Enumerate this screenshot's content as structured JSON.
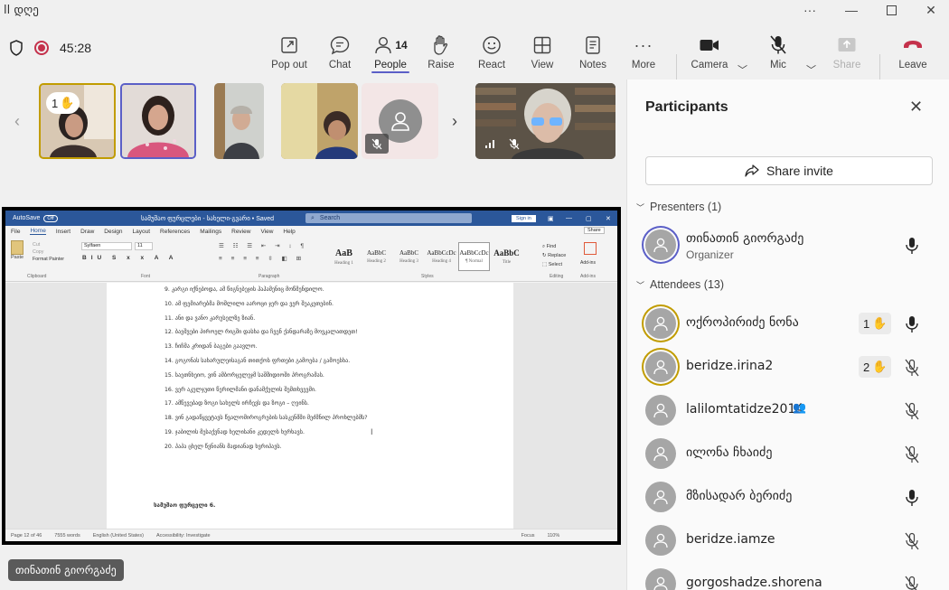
{
  "titlebar": {
    "title": "ll დღე"
  },
  "meeting": {
    "timer": "45:28"
  },
  "toolbar": {
    "pop_out": "Pop out",
    "chat": "Chat",
    "people": "People",
    "people_count": "14",
    "raise": "Raise",
    "react": "React",
    "view": "View",
    "notes": "Notes",
    "more": "More",
    "camera": "Camera",
    "mic": "Mic",
    "share": "Share",
    "leave": "Leave"
  },
  "thumbnails": {
    "hand_count": "1"
  },
  "word": {
    "autosave": "AutoSave",
    "autosave_state": "Off",
    "doc_title": "სამუშაო ფურცლები - სახელი-გვარი • Saved",
    "search": "Search",
    "signin": "Sign in",
    "menus": [
      "File",
      "Home",
      "Insert",
      "Draw",
      "Design",
      "Layout",
      "References",
      "Mailings",
      "Review",
      "View",
      "Help"
    ],
    "share": "Share",
    "clipboard": "Clipboard",
    "paste": "Paste",
    "cut": "Cut",
    "copy": "Copy",
    "format_painter": "Format Painter",
    "font": "Font",
    "font_name": "Sylfaen",
    "font_size": "11",
    "paragraph": "Paragraph",
    "styles_label": "Styles",
    "styles": [
      {
        "sample": "AaB",
        "name": "Heading 1"
      },
      {
        "sample": "AaBbC",
        "name": "Heading 2"
      },
      {
        "sample": "AaBbC",
        "name": "Heading 3"
      },
      {
        "sample": "AaBbCcDc",
        "name": "Heading 4"
      },
      {
        "sample": "AaBbCcDc",
        "name": "¶ Normal"
      },
      {
        "sample": "AaBbC",
        "name": "Title"
      }
    ],
    "editing": "Editing",
    "find": "Find",
    "replace": "Replace",
    "select": "Select",
    "addins": "Add-ins",
    "lines": [
      "9.   კარგი იქნებოდა, ამ წიგნებეჯის ჰაჰამენიც მოწმენდილო.",
      "10. ამ ფემიარებმა მოშლილი ააროცი ჯერ და ვერ შეაკეთებინ.",
      "11. ანი და ვანო კარუსელზე ზიან.",
      "12. ბავშვები პიროელ რიგში დასხა და ჩვენ ქანდარაზე მოვკალათდეთ!",
      "13. ჩიჩმა კრიდან ბაგები გაავლო.",
      "14. გოგონას სახარულეისაგან თითქოს ფრთები გამოება / გამოესხა.",
      "15. საეთნხეიო, ვინ ამბორცელეჯმ საშშიდიოში პროგრამას.",
      "16. ვერ აკულჯუთი წერილმანი დანამქულის შემთხვევმი.",
      "17. ამწევებად ზოგი სახელს ირჩევს და ზოგი – ღვინს.",
      "18. ვინ გადაწყვეტავს წვალომიროგრების სასკენმში მეძმნილ პროხლებმს?",
      "19. ჯაბილის მესაქვნად ხელისანი კედელს ხერხავს.",
      "20. პაპა ცხელ წვნიანს მადიანად ხვრიპავს."
    ],
    "bottom_heading": "სამუშაო ფურცელი 6.",
    "status": [
      "Page 12 of 46",
      "7555 words",
      "English (United States)",
      "Accessibility: Investigate",
      "Focus",
      "110%"
    ]
  },
  "stage": {
    "name_tag": "თინათინ გიორგაძე"
  },
  "participants": {
    "title": "Participants",
    "invite": "Share invite",
    "presenters_header": "Presenters (1)",
    "attendees_header": "Attendees (13)",
    "presenter": {
      "name": "თინათინ გიორგაძე",
      "role": "Organizer"
    },
    "attendees": [
      {
        "name": "ოქროპირიძე ნონა",
        "hand": "1",
        "mic": "on"
      },
      {
        "name": "beridze.irina2",
        "hand": "2",
        "mic": "off"
      },
      {
        "name": "lalilomtatidze2014",
        "mic": "off"
      },
      {
        "name": "ილონა ჩხაიძე",
        "mic": "off"
      },
      {
        "name": "მზისადარ ბერიძე",
        "mic": "on"
      },
      {
        "name": "beridze.iamze",
        "mic": "off"
      },
      {
        "name": "gorgoshadze.shorena",
        "mic": "off"
      }
    ]
  }
}
